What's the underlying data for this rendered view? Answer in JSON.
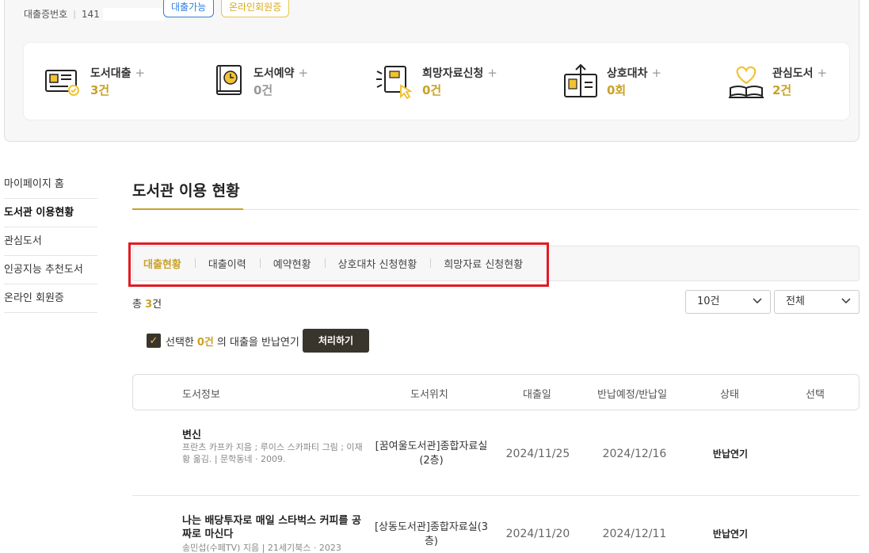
{
  "card": {
    "number_label": "대출증번호",
    "number_value": "141",
    "tag_loanable": "대출가능",
    "tag_online": "온라인회원증"
  },
  "stats": [
    {
      "label": "도서대출",
      "plus": "+",
      "count": "3건",
      "icon": "book-loan-icon"
    },
    {
      "label": "도서예약",
      "plus": "+",
      "count": "0건",
      "icon": "book-reserve-icon"
    },
    {
      "label": "희망자료신청",
      "plus": "+",
      "count": "0건",
      "icon": "wish-request-icon"
    },
    {
      "label": "상호대차",
      "plus": "+",
      "count": "0회",
      "icon": "interlibrary-loan-icon"
    },
    {
      "label": "관심도서",
      "plus": "+",
      "count": "2건",
      "icon": "heart-book-icon"
    }
  ],
  "sidebar": {
    "items": [
      {
        "label": "마이페이지 홈"
      },
      {
        "label": "도서관 이용현황"
      },
      {
        "label": "관심도서"
      },
      {
        "label": "인공지능 추천도서"
      },
      {
        "label": "온라인 회원증"
      }
    ]
  },
  "main": {
    "title": "도서관 이용 현황",
    "tabs": [
      {
        "label": "대출현황"
      },
      {
        "label": "대출이력"
      },
      {
        "label": "예약현황"
      },
      {
        "label": "상호대차 신청현황"
      },
      {
        "label": "희망자료 신청현황"
      }
    ],
    "total_prefix": "총 ",
    "total_count": "3",
    "total_suffix": "건",
    "page_size": "10건",
    "filter": "전체",
    "bulk_prefix": "선택한",
    "bulk_count": "0건",
    "bulk_suffix": "의 대출을 반납연기",
    "process_button": "처리하기"
  },
  "table": {
    "headers": [
      "도서정보",
      "도서위치",
      "대출일",
      "반납예정/반납일",
      "상태",
      "선택"
    ],
    "rows": [
      {
        "title": "변신",
        "meta": "프란츠 카프카 지음 ; 루이스 스카파티 그림 ; 이재황 옮김. | 문학동네 · 2009.",
        "location": "[꿈여울도서관]종합자료실(2층)",
        "loan_date": "2024/11/25",
        "due_date": "2024/12/16",
        "status": "반납연기"
      },
      {
        "title": "나는 배당투자로 매일 스타벅스 커피를 공짜로 마신다",
        "meta": "송민섭(수페TV) 지음 | 21세기북스 · 2023",
        "location": "[상동도서관]종합자료실(3층)",
        "loan_date": "2024/11/20",
        "due_date": "2024/12/11",
        "status": "반납연기"
      }
    ]
  },
  "colors": {
    "accent": "#c9a227",
    "highlight_box": "#e21b24",
    "dark_button": "#3a352c",
    "link_blue": "#2f7de1"
  }
}
